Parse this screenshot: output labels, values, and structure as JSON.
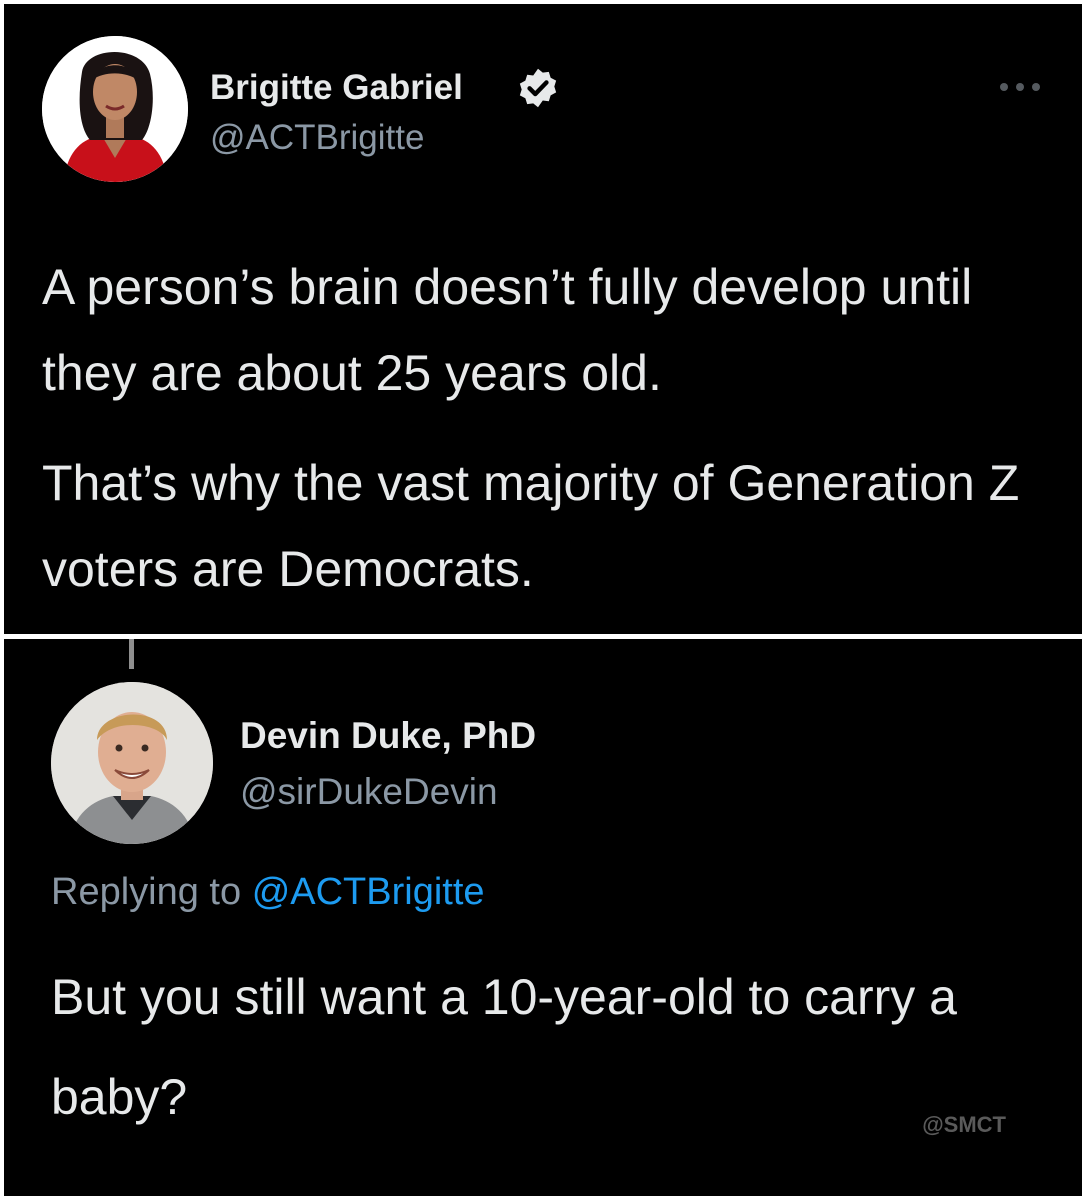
{
  "original_tweet": {
    "author_name": "Brigitte Gabriel",
    "author_handle": "@ACTBrigitte",
    "verified": true,
    "paragraphs": [
      "A person’s brain doesn’t fully develop until they are about 25 years old.",
      "That’s why the vast majority of Generation Z voters are Democrats."
    ]
  },
  "reply_tweet": {
    "author_name": "Devin Duke, PhD",
    "author_handle": "@sirDukeDevin",
    "replying_prefix": "Replying to",
    "replying_to": "@ACTBrigitte",
    "text": "But you still want a 10-year-old to carry a baby?"
  },
  "watermark": "@SMCT",
  "icons": {
    "verified": "verified-badge-icon",
    "more": "more-options-icon"
  },
  "colors": {
    "background": "#000000",
    "text": "#e7e9ea",
    "secondary_text": "#8b98a5",
    "mention": "#1d9bf0"
  }
}
